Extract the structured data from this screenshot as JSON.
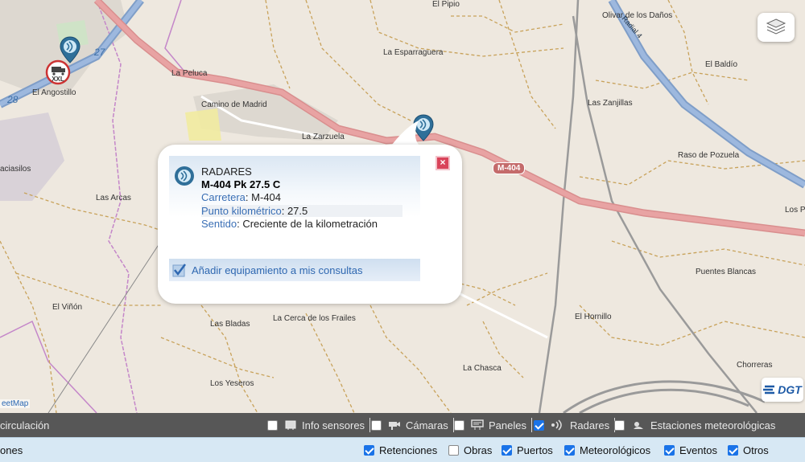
{
  "map": {
    "places": [
      {
        "name": "El Pipio"
      },
      {
        "name": "Olivar de los Daños"
      },
      {
        "name": "La Esparraguera"
      },
      {
        "name": "El Baldío"
      },
      {
        "name": "La Peluca"
      },
      {
        "name": "El Angostillo"
      },
      {
        "name": "Camino de Madrid"
      },
      {
        "name": "Las Zanjillas"
      },
      {
        "name": "La Zarzuela"
      },
      {
        "name": "Raso de Pozuela"
      },
      {
        "name": "aciasilos"
      },
      {
        "name": "Las Arcas"
      },
      {
        "name": "Los P"
      },
      {
        "name": "Puentes Blancas"
      },
      {
        "name": "El Viñón"
      },
      {
        "name": "El Hornillo"
      },
      {
        "name": "Las Bladas"
      },
      {
        "name": "La Cerca de los Frailes"
      },
      {
        "name": "Chorreras"
      },
      {
        "name": "La Chasca"
      },
      {
        "name": "Los Yeseros"
      }
    ],
    "road_label": "M-404",
    "highway_numbers": [
      "27",
      "28"
    ],
    "highway_name": "Radial 4",
    "xxl_label": "XXL",
    "attribution": "eetMap",
    "dgt_label": "DGT",
    "icons": {
      "layers": "layers-icon",
      "radar": "radar-marker-icon",
      "truck": "truck-xxl-icon"
    }
  },
  "popup": {
    "title": "RADARES",
    "subtitle": "M-404 Pk 27.5 C",
    "fields": [
      {
        "key": "Carretera",
        "value": "M-404"
      },
      {
        "key": "Punto kilométrico",
        "value": "27.5"
      },
      {
        "key": "Sentido",
        "value": "Creciente de la kilometración"
      }
    ],
    "separator": ": ",
    "add_label": "Añadir equipamiento a mis consultas",
    "close_label": "×"
  },
  "toolbar1": {
    "left_label": "circulación",
    "items": [
      {
        "label": "Info sensores",
        "checked": false
      },
      {
        "label": "Cámaras",
        "checked": false
      },
      {
        "label": "Paneles",
        "checked": false
      },
      {
        "label": "Radares",
        "checked": true
      },
      {
        "label": "Estaciones meteorológicas",
        "checked": false
      }
    ]
  },
  "toolbar2": {
    "left_label": "ones",
    "items": [
      {
        "label": "Retenciones",
        "checked": true
      },
      {
        "label": "Obras",
        "checked": false
      },
      {
        "label": "Puertos",
        "checked": true
      },
      {
        "label": "Meteorológicos",
        "checked": true
      },
      {
        "label": "Eventos",
        "checked": true
      },
      {
        "label": "Otros",
        "checked": true
      }
    ]
  },
  "colors": {
    "road_main": "#e8a3a3",
    "highway": "#8eaad4",
    "toolbar_dark": "#575757",
    "toolbar_light": "#d7e8f4",
    "checkbox_on": "#1a73e8"
  }
}
